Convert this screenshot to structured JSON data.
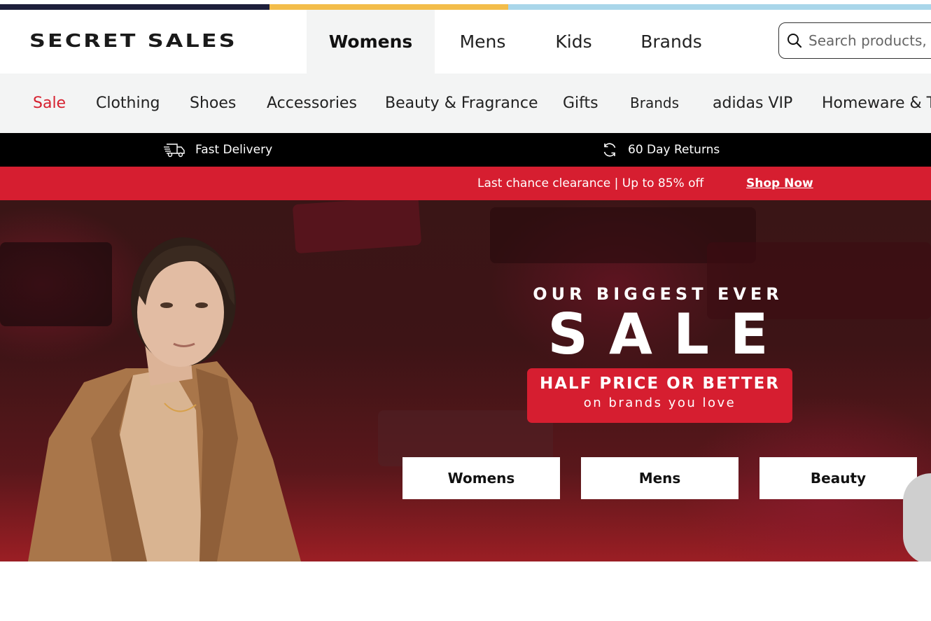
{
  "colors": {
    "strip": [
      "#1d1f3b",
      "#f3bd4a",
      "#a9d6ea"
    ],
    "accent_red": "#d61e30",
    "active_tab_bg": "#f3f4f4",
    "delivery_bar_bg": "#000000"
  },
  "header": {
    "logo": "SECRET SALES",
    "tabs": [
      {
        "label": "Womens",
        "active": true
      },
      {
        "label": "Mens"
      },
      {
        "label": "Kids"
      },
      {
        "label": "Brands"
      }
    ],
    "search": {
      "placeholder": "Search products, b",
      "icon": "search-icon"
    }
  },
  "categories": [
    "Sale",
    "Clothing",
    "Shoes",
    "Accessories",
    "Beauty & Fragrance",
    "Gifts",
    "Brands",
    "adidas VIP",
    "Homeware & T"
  ],
  "delivery_bar": {
    "items": [
      {
        "icon": "delivery-truck-icon",
        "label": "Fast Delivery"
      },
      {
        "icon": "returns-icon",
        "label": "60 Day Returns"
      }
    ]
  },
  "promo_bar": {
    "message": "Last chance clearance | Up to 85% off",
    "link": "Shop Now"
  },
  "hero": {
    "eyebrow": "OUR BIGGEST EVER",
    "headline": "SALE",
    "badge_line1": "HALF PRICE OR BETTER",
    "badge_line2": "on brands you love",
    "buttons": [
      "Womens",
      "Mens",
      "Beauty"
    ]
  }
}
